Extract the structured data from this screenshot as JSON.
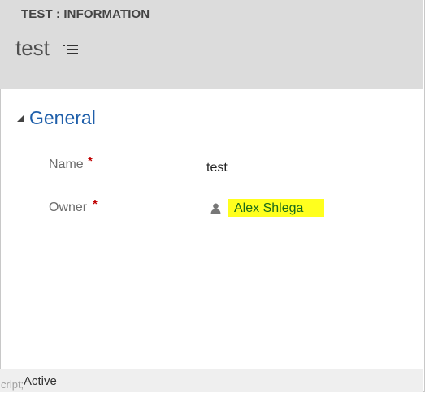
{
  "header": {
    "entity_label": "TEST : INFORMATION",
    "record_title": "test",
    "menu_icon": "list-menu-icon"
  },
  "section": {
    "title": "General",
    "toggle_icon": "collapse-triangle-icon",
    "fields": {
      "name": {
        "label": "Name",
        "required_marker": "*",
        "value": "test"
      },
      "owner": {
        "label": "Owner",
        "required_marker": "*",
        "value": "Alex Shlega",
        "icon": "user-icon",
        "highlight_color": "#ffff1e"
      }
    }
  },
  "statusbar": {
    "clipped_text": "cript;",
    "status": "Active"
  },
  "colors": {
    "header_bg": "#dcdcdc",
    "section_title": "#1f5faa",
    "required": "#c00000",
    "lookup_text": "#1a6b1a"
  }
}
